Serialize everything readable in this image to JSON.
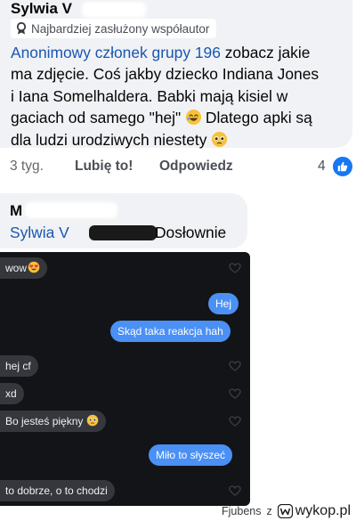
{
  "comment1": {
    "author_name": "Sylwia V",
    "badge_label": "Najbardziej zasłużony współautor",
    "mention": "Anonimowy członek grupy 196",
    "line1_rest": " zobacz jakie",
    "line2": "ma zdjęcie. Coś jakby dziecko Indiana Jones",
    "line3": "i Iana Somelhaldera. Babki mają kisiel w",
    "line4_a": "gaciach od samego \"hej\" ",
    "line4_b": " Dlatego apki są",
    "line5": "dla ludzi urodziwych niestety ",
    "emoji_1": "rolling-on-floor-laughing-emoji",
    "emoji_2": "pleading-face-emoji"
  },
  "actions": {
    "time": "3 tyg.",
    "like_label": "Lubię to!",
    "reply_label": "Odpowiedz",
    "like_count": "4"
  },
  "comment2": {
    "author_name": "M",
    "mention": "Sylwia V",
    "text": "Dosłownie"
  },
  "chat": {
    "messages": [
      {
        "side": "in",
        "text": "wow",
        "emoji": "heart-eyes-emoji"
      },
      {
        "side": "out",
        "text": "Hej"
      },
      {
        "side": "out",
        "text": "Skąd taka reakcja hah"
      },
      {
        "side": "in",
        "text": "hej cf"
      },
      {
        "side": "in",
        "text": "xd"
      },
      {
        "side": "in",
        "text": "Bo jesteś piękny",
        "emoji": "pleading-face-emoji"
      },
      {
        "side": "out",
        "text": "Miło to słyszeć"
      },
      {
        "side": "in",
        "text": "to dobrze, o to chodzi"
      }
    ]
  },
  "footer": {
    "author": "Fjubens",
    "separator": "z",
    "site": "wykop.pl"
  },
  "colors": {
    "comment_bg": "#f0f2f5",
    "mention_blue": "#1a56b0",
    "like_blue": "#1877f2",
    "chat_bg": "#131417",
    "bubble_in": "#35373c",
    "bubble_out": "#4a90f5"
  }
}
